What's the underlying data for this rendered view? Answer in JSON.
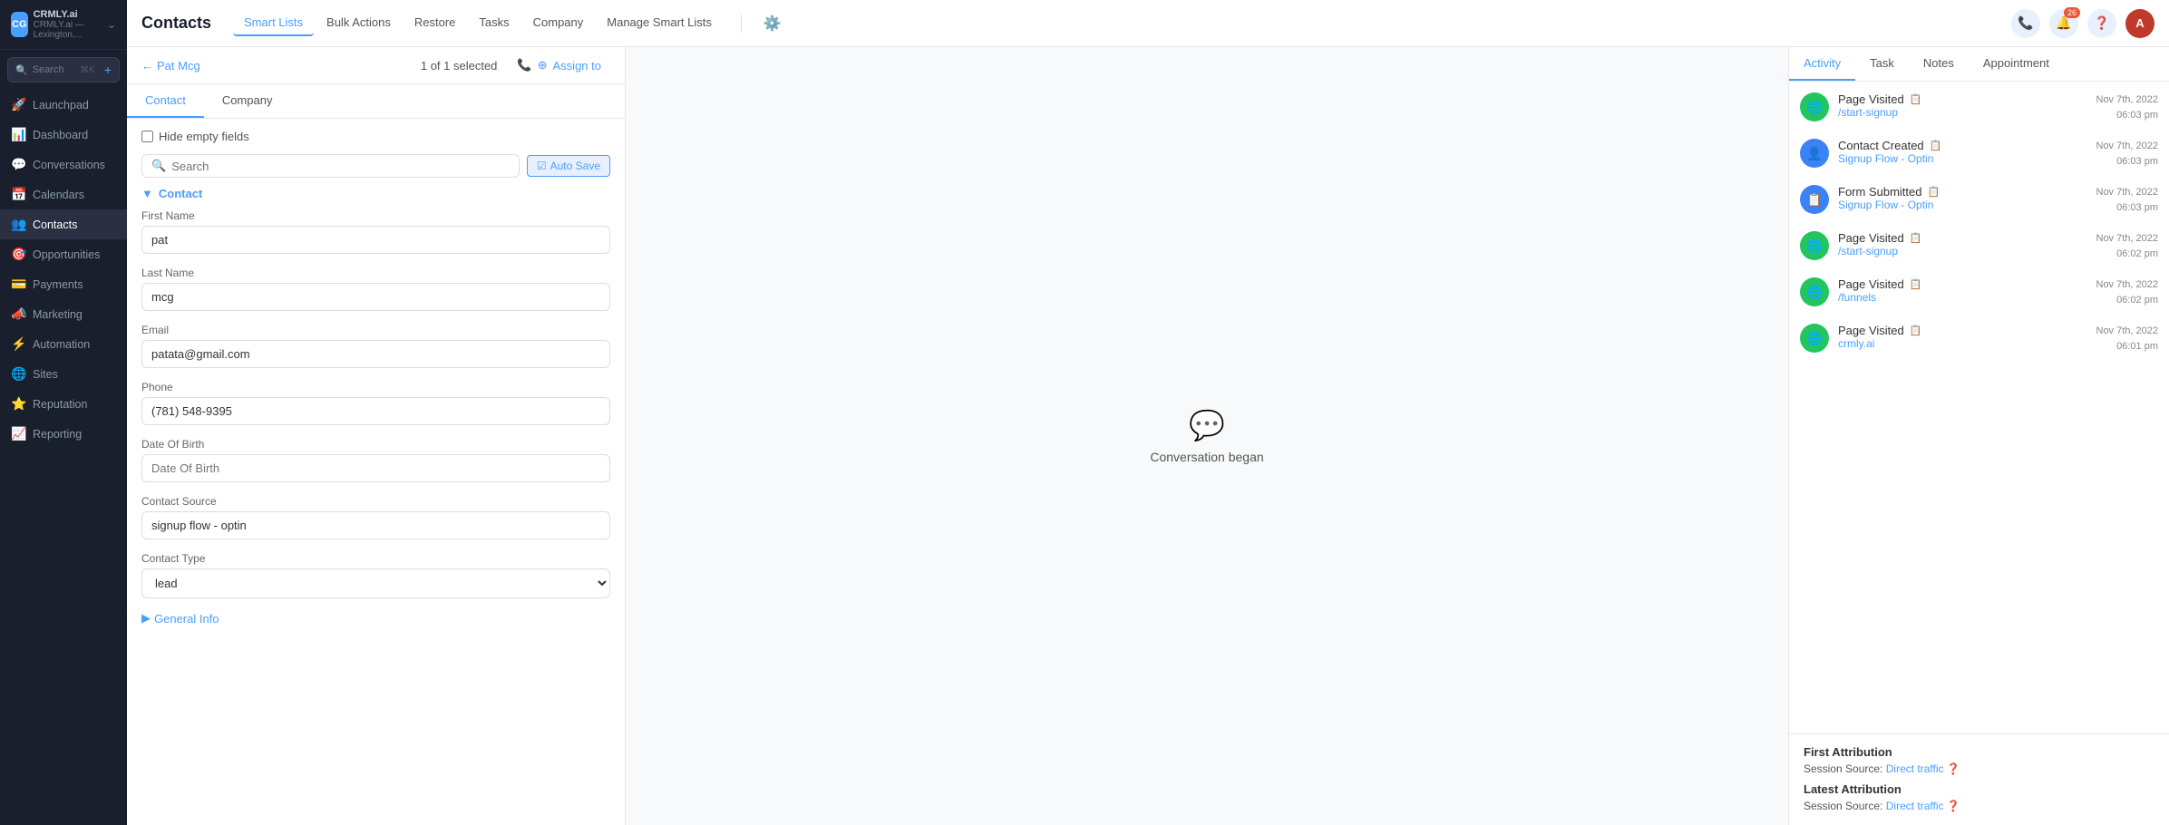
{
  "sidebar": {
    "logo_text": "CG",
    "brand": "CRMLY.ai",
    "workspace": "CRMLY.ai — Lexington,...",
    "search_placeholder": "Search",
    "search_shortcut": "⌘K",
    "items": [
      {
        "id": "launchpad",
        "label": "Launchpad",
        "icon": "🚀"
      },
      {
        "id": "dashboard",
        "label": "Dashboard",
        "icon": "📊"
      },
      {
        "id": "conversations",
        "label": "Conversations",
        "icon": "💬"
      },
      {
        "id": "calendars",
        "label": "Calendars",
        "icon": "📅"
      },
      {
        "id": "contacts",
        "label": "Contacts",
        "icon": "👥",
        "active": true
      },
      {
        "id": "opportunities",
        "label": "Opportunities",
        "icon": "🎯"
      },
      {
        "id": "payments",
        "label": "Payments",
        "icon": "💳"
      },
      {
        "id": "marketing",
        "label": "Marketing",
        "icon": "📣"
      },
      {
        "id": "automation",
        "label": "Automation",
        "icon": "⚡"
      },
      {
        "id": "sites",
        "label": "Sites",
        "icon": "🌐"
      },
      {
        "id": "reputation",
        "label": "Reputation",
        "icon": "⭐"
      },
      {
        "id": "reporting",
        "label": "Reporting",
        "icon": "📈"
      }
    ]
  },
  "topbar": {
    "title": "Contacts",
    "nav_items": [
      {
        "label": "Smart Lists",
        "active": true
      },
      {
        "label": "Bulk Actions",
        "active": false
      },
      {
        "label": "Restore",
        "active": false
      },
      {
        "label": "Tasks",
        "active": false
      },
      {
        "label": "Company",
        "active": false
      },
      {
        "label": "Manage Smart Lists",
        "active": false
      }
    ]
  },
  "back": {
    "label": "Pat Mcg",
    "selected_text": "1 of 1 selected",
    "assign_label": "Assign to"
  },
  "contact_form": {
    "tabs": [
      {
        "label": "Contact",
        "active": true
      },
      {
        "label": "Company",
        "active": false
      }
    ],
    "hide_empty_label": "Hide empty fields",
    "search_placeholder": "Search",
    "auto_save_label": "Auto Save",
    "section_label": "Contact",
    "fields": [
      {
        "id": "first_name",
        "label": "First Name",
        "value": "pat",
        "placeholder": ""
      },
      {
        "id": "last_name",
        "label": "Last Name",
        "value": "mcg",
        "placeholder": ""
      },
      {
        "id": "email",
        "label": "Email",
        "value": "patata@gmail.com",
        "placeholder": ""
      },
      {
        "id": "phone",
        "label": "Phone",
        "value": "(781) 548-9395",
        "placeholder": ""
      },
      {
        "id": "date_of_birth",
        "label": "Date Of Birth",
        "value": "",
        "placeholder": "Date Of Birth"
      },
      {
        "id": "contact_source",
        "label": "Contact Source",
        "value": "signup flow - optin",
        "placeholder": ""
      },
      {
        "id": "contact_type",
        "label": "Contact Type",
        "value": "lead",
        "placeholder": ""
      }
    ],
    "general_info_label": "General Info"
  },
  "conversation": {
    "icon": "💬",
    "text": "Conversation began"
  },
  "activity": {
    "tabs": [
      {
        "label": "Activity",
        "active": true
      },
      {
        "label": "Task",
        "active": false
      },
      {
        "label": "Notes",
        "active": false
      },
      {
        "label": "Appointment",
        "active": false
      }
    ],
    "items": [
      {
        "type": "page_visited",
        "title": "Page Visited",
        "icon_type": "green",
        "icon": "🌐",
        "link": "/start-signup",
        "date": "Nov 7th, 2022",
        "time": "06:03 pm"
      },
      {
        "type": "contact_created",
        "title": "Contact Created",
        "icon_type": "blue",
        "icon": "👤",
        "link": "Signup Flow - Optin",
        "date": "Nov 7th, 2022",
        "time": "06:03 pm"
      },
      {
        "type": "form_submitted",
        "title": "Form Submitted",
        "icon_type": "blue",
        "icon": "📋",
        "link": "Signup Flow - Optin",
        "date": "Nov 7th, 2022",
        "time": "06:03 pm"
      },
      {
        "type": "page_visited",
        "title": "Page Visited",
        "icon_type": "green",
        "icon": "🌐",
        "link": "/start-signup",
        "date": "Nov 7th, 2022",
        "time": "06:02 pm"
      },
      {
        "type": "page_visited",
        "title": "Page Visited",
        "icon_type": "green",
        "icon": "🌐",
        "link": "/funnels",
        "date": "Nov 7th, 2022",
        "time": "06:02 pm"
      },
      {
        "type": "page_visited",
        "title": "Page Visited",
        "icon_type": "green",
        "icon": "🌐",
        "link": "crmly.ai",
        "date": "Nov 7th, 2022",
        "time": "06:01 pm"
      }
    ],
    "first_attribution": {
      "title": "First Attribution",
      "session_source_label": "Session Source:",
      "session_source_value": "Direct traffic",
      "help_icon": "?"
    },
    "latest_attribution": {
      "title": "Latest Attribution",
      "session_source_label": "Session Source:",
      "session_source_value": "Direct traffic",
      "help_icon": "?"
    }
  }
}
